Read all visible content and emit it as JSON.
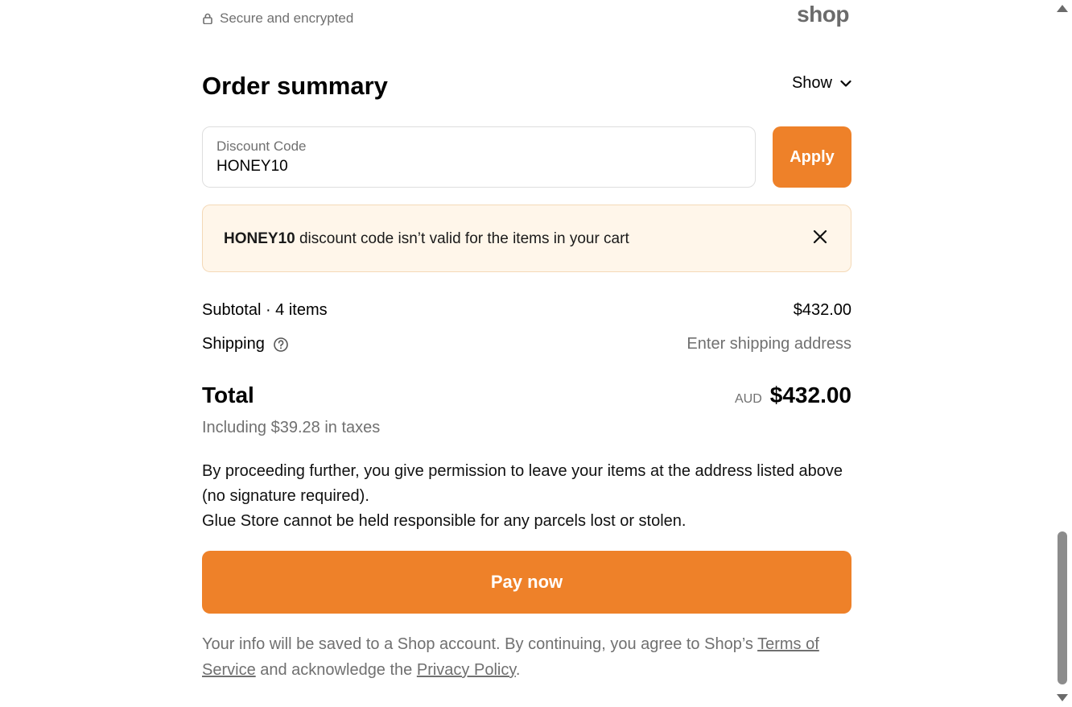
{
  "header": {
    "secure_text": "Secure and encrypted",
    "logo_text": "shop"
  },
  "summary": {
    "title": "Order summary",
    "toggle_label": "Show"
  },
  "discount": {
    "label": "Discount Code",
    "value": "HONEY10",
    "apply_label": "Apply"
  },
  "alert": {
    "code": "HONEY10",
    "message": " discount code isn’t valid for the items in your cart"
  },
  "lines": {
    "subtotal_label": "Subtotal · 4 items",
    "subtotal_value": "$432.00",
    "shipping_label": "Shipping",
    "shipping_value": "Enter shipping address"
  },
  "total": {
    "label": "Total",
    "currency": "AUD",
    "amount": "$432.00",
    "tax_note": "Including $39.28 in taxes"
  },
  "consent": {
    "line1": "By proceeding further, you give permission to leave your items at the address listed above (no signature required).",
    "line2": "Glue Store cannot be held responsible for any parcels lost or stolen."
  },
  "pay": {
    "label": "Pay now"
  },
  "legal": {
    "prefix": "Your info will be saved to a Shop account. By continuing, you agree to Shop’s ",
    "terms_link": "Terms of Service",
    "middle": " and acknowledge the ",
    "privacy_link": "Privacy Policy",
    "suffix": "."
  },
  "colors": {
    "accent": "#ee8129",
    "alert_bg": "#fff6ea",
    "muted_text": "#707070"
  },
  "icons": {
    "secure": "lock-icon",
    "toggle": "chevron-down-icon",
    "alert_close": "close-icon",
    "shipping_help": "help-circle-icon"
  }
}
